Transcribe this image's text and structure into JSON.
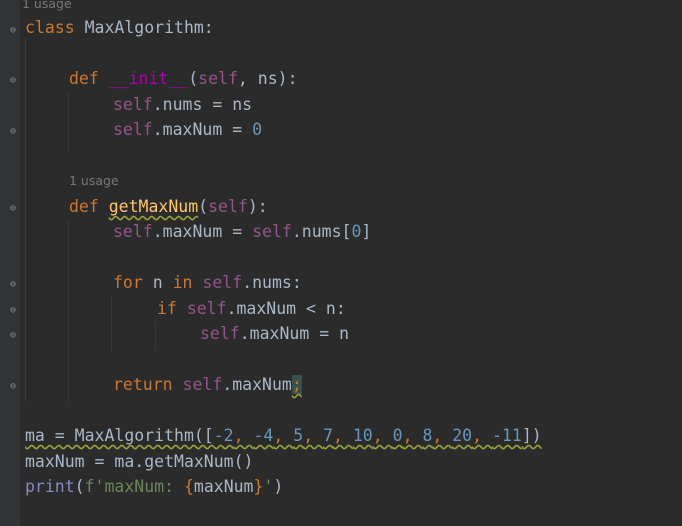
{
  "hints": {
    "usage_top": "1 usage",
    "usage_method": "1 usage"
  },
  "code": {
    "l1_kw": "class",
    "l1_name": " MaxAlgorithm:",
    "l2_kw": "def",
    "l2_name": "__init__",
    "l2_open": "(",
    "l2_self": "self",
    "l2_rest": ", ns):",
    "l3_self": "self",
    "l3_rest": ".nums = ns",
    "l4_self": "self",
    "l4_rest": ".maxNum = ",
    "l4_num": "0",
    "l5_kw": "def",
    "l5_name": "getMaxNum",
    "l5_open": "(",
    "l5_self": "self",
    "l5_close": "):",
    "l6_self1": "self",
    "l6_mid": ".maxNum = ",
    "l6_self2": "self",
    "l6_rest": ".nums[",
    "l6_num": "0",
    "l6_end": "]",
    "l7_kw1": "for",
    "l7_mid": " n ",
    "l7_kw2": "in",
    "l7_self": "self",
    "l7_rest": ".nums:",
    "l8_kw": "if",
    "l8_self": "self",
    "l8_rest": ".maxNum < n:",
    "l9_self": "self",
    "l9_rest": ".maxNum = n",
    "l10_kw": "return",
    "l10_self": "self",
    "l10_rest": ".maxNum",
    "l10_semi": ";",
    "l11_pre": "ma = MaxAlgorithm([",
    "l11_values": [
      "-2",
      "-4",
      "5",
      "7",
      "10",
      "0",
      "8",
      "20",
      "-11"
    ],
    "l11_post": "])",
    "l12": "maxNum = ma.getMaxNum()",
    "l13_fn": "print",
    "l13_open": "(",
    "l13_str1": "f'maxNum: ",
    "l13_brace1": "{",
    "l13_var": "maxNum",
    "l13_brace2": "}",
    "l13_str2": "'",
    "l13_close": ")"
  },
  "colors": {
    "background": "#2b2b2b",
    "keyword": "#cc7832",
    "self": "#94558d",
    "number": "#6897bb",
    "string": "#6a8759",
    "function_def": "#ffc66d",
    "text": "#a9b7c6"
  }
}
